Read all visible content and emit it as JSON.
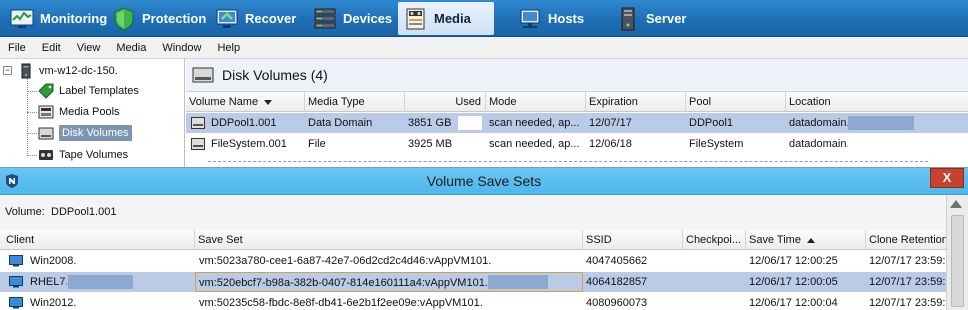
{
  "nav": {
    "tabs": [
      {
        "label": "Monitoring",
        "icon": "monitoring-icon"
      },
      {
        "label": "Protection",
        "icon": "shield-icon"
      },
      {
        "label": "Recover",
        "icon": "recover-icon"
      },
      {
        "label": "Devices",
        "icon": "devices-icon"
      },
      {
        "label": "Media",
        "icon": "media-icon",
        "active": true
      },
      {
        "label": "Hosts",
        "icon": "hosts-icon"
      },
      {
        "label": "Server",
        "icon": "server-icon"
      }
    ]
  },
  "menu": [
    "File",
    "Edit",
    "View",
    "Media",
    "Window",
    "Help"
  ],
  "tree": {
    "root": "vm-w12-dc-150.",
    "items": [
      {
        "label": "Label Templates",
        "icon": "tag-icon"
      },
      {
        "label": "Media Pools",
        "icon": "media-pool-icon"
      },
      {
        "label": "Disk Volumes",
        "icon": "disk-volume-icon",
        "selected": true
      },
      {
        "label": "Tape Volumes",
        "icon": "tape-icon"
      }
    ]
  },
  "disk_volumes": {
    "title": "Disk Volumes (4)",
    "columns": [
      "Volume Name",
      "Media Type",
      "Used",
      "Mode",
      "Expiration",
      "Pool",
      "Location"
    ],
    "rows": [
      [
        "DDPool1.001",
        "Data Domain",
        "3851 GB",
        "scan needed, ap...",
        "12/07/17",
        "DDPool1",
        "datadomain."
      ],
      [
        "FileSystem.001",
        "File",
        "3925 MB",
        "scan needed, ap...",
        "12/06/18",
        "FileSystem",
        "datadomain."
      ]
    ]
  },
  "dialog": {
    "title": "Volume Save Sets",
    "close": "X",
    "volume_label": "Volume:",
    "volume_value": "DDPool1.001",
    "columns": [
      "Client",
      "Save Set",
      "SSID",
      "Checkpoi...",
      "Save Time",
      "Clone Retention"
    ],
    "rows": [
      [
        "Win2008.",
        "vm:5023a780-cee1-6a87-42e7-06d2cd2c4d46:vAppVM101.",
        "4047405662",
        "",
        "12/06/17 12:00:25",
        "12/07/17 23:59:"
      ],
      [
        "RHEL7.",
        "vm:520ebcf7-b98a-382b-0407-814e160111a4:vAppVM101.",
        "4064182857",
        "",
        "12/06/17 12:00:05",
        "12/07/17 23:59:"
      ],
      [
        "Win2012.",
        "vm:50235c58-fbdc-8e8f-db41-6e2b1f2ee09e:vAppVM101.",
        "4080960073",
        "",
        "12/06/17 12:00:04",
        "12/07/17 23:59:"
      ]
    ]
  },
  "colors": {
    "nav_bar": "#1f6fb6",
    "selected_row": "#b9cbe6",
    "dialog_title_bar": "#56bbee",
    "close_button": "#c7412f"
  }
}
